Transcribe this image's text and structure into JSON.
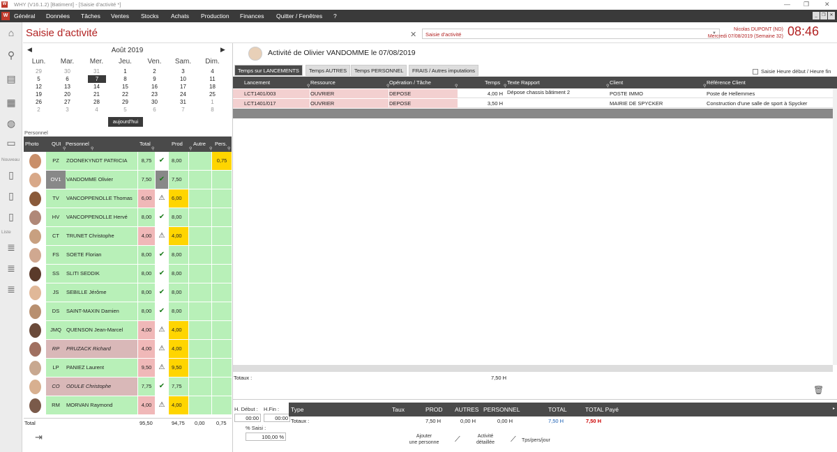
{
  "window": {
    "title": "WHY (V16.1.2)  [Batiment] - [Saisie d'activité *]"
  },
  "menu": [
    "Général",
    "Données",
    "Tâches",
    "Ventes",
    "Stocks",
    "Achats",
    "Production",
    "Finances",
    "Quitter / Fenêtres",
    "?"
  ],
  "leftbar": {
    "nouveau": "Nouveau",
    "liste": "Liste"
  },
  "header": {
    "title": "Saisie d'activité",
    "close": "✕",
    "selector": "Saisie d'activité",
    "user": "Nicolas DUPONT (ND)",
    "date": "Mercredi 07/08/2019 (Semaine 32)",
    "clock": "08:46"
  },
  "calendar": {
    "month": "Août 2019",
    "days": [
      "Lun.",
      "Mar.",
      "Mer.",
      "Jeu.",
      "Ven.",
      "Sam.",
      "Dim."
    ],
    "weeks": [
      [
        "29",
        "30",
        "31",
        "1",
        "2",
        "3",
        "4"
      ],
      [
        "5",
        "6",
        "7",
        "8",
        "9",
        "10",
        "11"
      ],
      [
        "12",
        "13",
        "14",
        "15",
        "16",
        "17",
        "18"
      ],
      [
        "19",
        "20",
        "21",
        "22",
        "23",
        "24",
        "25"
      ],
      [
        "26",
        "27",
        "28",
        "29",
        "30",
        "31",
        "1"
      ],
      [
        "2",
        "3",
        "4",
        "5",
        "6",
        "7",
        "8"
      ]
    ],
    "today": "aujourd'hui"
  },
  "personnel": {
    "label": "Personnel",
    "columns": {
      "photo": "Photo",
      "qui": "QUI",
      "personnel": "Personnel",
      "total": "Total",
      "prod": "Prod",
      "autre": "Autre",
      "pers": "Pers."
    },
    "rows": [
      {
        "qui": "PZ",
        "name": "ZOONEKYNDT PATRICIA",
        "total": "8,75",
        "status": "✔",
        "prod": "8,00",
        "autre": "",
        "pers": "0,75",
        "face": "#c98f6a"
      },
      {
        "qui": "OV1",
        "name": "VANDOMME Olivier",
        "total": "7,50",
        "status": "✔",
        "prod": "7,50",
        "autre": "",
        "pers": "",
        "face": "#d8a888"
      },
      {
        "qui": "TV",
        "name": "VANCOPPENOLLE Thomas",
        "total": "6,00",
        "status": "⚠",
        "prod": "6,00",
        "autre": "",
        "pers": "",
        "face": "#8a5a3a"
      },
      {
        "qui": "HV",
        "name": "VANCOPPENOLLE Hervé",
        "total": "8,00",
        "status": "✔",
        "prod": "8,00",
        "autre": "",
        "pers": "",
        "face": "#b08878"
      },
      {
        "qui": "CT",
        "name": "TRUNET Christophe",
        "total": "4,00",
        "status": "⚠",
        "prod": "4,00",
        "autre": "",
        "pers": "",
        "face": "#c8a080"
      },
      {
        "qui": "FS",
        "name": "SOETE Florian",
        "total": "8,00",
        "status": "✔",
        "prod": "8,00",
        "autre": "",
        "pers": "",
        "face": "#d0a890"
      },
      {
        "qui": "SS",
        "name": "SLITI SEDDIK",
        "total": "8,00",
        "status": "✔",
        "prod": "8,00",
        "autre": "",
        "pers": "",
        "face": "#5a3a2a"
      },
      {
        "qui": "JS",
        "name": "SEBILLE Jérôme",
        "total": "8,00",
        "status": "✔",
        "prod": "8,00",
        "autre": "",
        "pers": "",
        "face": "#e0b898"
      },
      {
        "qui": "DS",
        "name": "SAINT-MAXIN Damien",
        "total": "8,00",
        "status": "✔",
        "prod": "8,00",
        "autre": "",
        "pers": "",
        "face": "#b89070"
      },
      {
        "qui": "JMQ",
        "name": "QUENSON Jean-Marcel",
        "total": "4,00",
        "status": "⚠",
        "prod": "4,00",
        "autre": "",
        "pers": "",
        "face": "#6a4a3a"
      },
      {
        "qui": "RP",
        "name": "PRUZACK Richard",
        "total": "4,00",
        "status": "⚠",
        "prod": "4,00",
        "autre": "",
        "pers": "",
        "face": "#a07060",
        "italic": true
      },
      {
        "qui": "LP",
        "name": "PANIEZ Laurent",
        "total": "9,50",
        "status": "⚠",
        "prod": "9,50",
        "autre": "",
        "pers": "",
        "face": "#c8a890"
      },
      {
        "qui": "CO",
        "name": "ODULE Christophe",
        "total": "7,75",
        "status": "✔",
        "prod": "7,75",
        "autre": "",
        "pers": "",
        "face": "#d8b090",
        "italic": true
      },
      {
        "qui": "RM",
        "name": "MORVAN Raymond",
        "total": "4,00",
        "status": "⚠",
        "prod": "4,00",
        "autre": "",
        "pers": "",
        "face": "#7a5a4a"
      }
    ],
    "totals": {
      "label": "Total",
      "total": "95,50",
      "prod": "94,75",
      "autre": "0,00",
      "pers": "0,75"
    }
  },
  "activity": {
    "title": "Activité de Olivier VANDOMME le 07/08/2019",
    "tabs": [
      "Temps sur LANCEMENTS",
      "Temps AUTRES",
      "Temps PERSONNEL",
      "FRAIS / Autres imputations"
    ],
    "checkbox": "Saisie Heure début / Heure fin",
    "columns": {
      "lancement": "Lancement",
      "ressource": "Ressource",
      "operation": "Opération / Tâche",
      "temps": "Temps",
      "texte": "Texte Rapport",
      "client": "Client",
      "reference": "Référence Client"
    },
    "rows": [
      {
        "lancement": "LCT1401/003",
        "ressource": "OUVRIER",
        "operation": "DEPOSE",
        "temps": "4,00 H",
        "texte": "Dépose chassis bâtiment 2",
        "client": "POSTE IMMO",
        "reference": "Poste de Hellemmes"
      },
      {
        "lancement": "LCT1401/017",
        "ressource": "OUVRIER",
        "operation": "DEPOSE",
        "temps": "3,50 H",
        "texte": "",
        "client": "MAIRIE DE SPYCKER",
        "reference": "Construction d'une salle de sport à Spycker"
      }
    ],
    "totaux_label": "Totaux :",
    "totaux_val": "7,50 H"
  },
  "summary": {
    "hdebut_label": "H. Début :",
    "hfin_label": "H.Fin :",
    "hdebut": "00:00",
    "hfin": "00:00",
    "saisi_label": "% Saisi :",
    "saisi": "100,00 %",
    "columns": {
      "type": "Type",
      "taux": "Taux",
      "prod": "PROD",
      "autres": "AUTRES",
      "personnel": "PERSONNEL",
      "total": "TOTAL",
      "total_paye": "TOTAL Payé"
    },
    "row": {
      "label": "Totaux :",
      "prod": "7,50 H",
      "autres": "0,00 H",
      "personnel": "0,00 H",
      "total": "7,50 H",
      "total_paye": "7,50 H"
    },
    "buttons": {
      "ajouter": "Ajouter\nune personne",
      "activite": "Activité\ndétaillée",
      "tps": "Tps/pers/jour"
    }
  },
  "colors": {
    "green": "#b8f0b8",
    "pink": "#f0b8b8",
    "yellow": "#ffd500",
    "dark": "#3a3a3a",
    "brand": "#b22222"
  }
}
